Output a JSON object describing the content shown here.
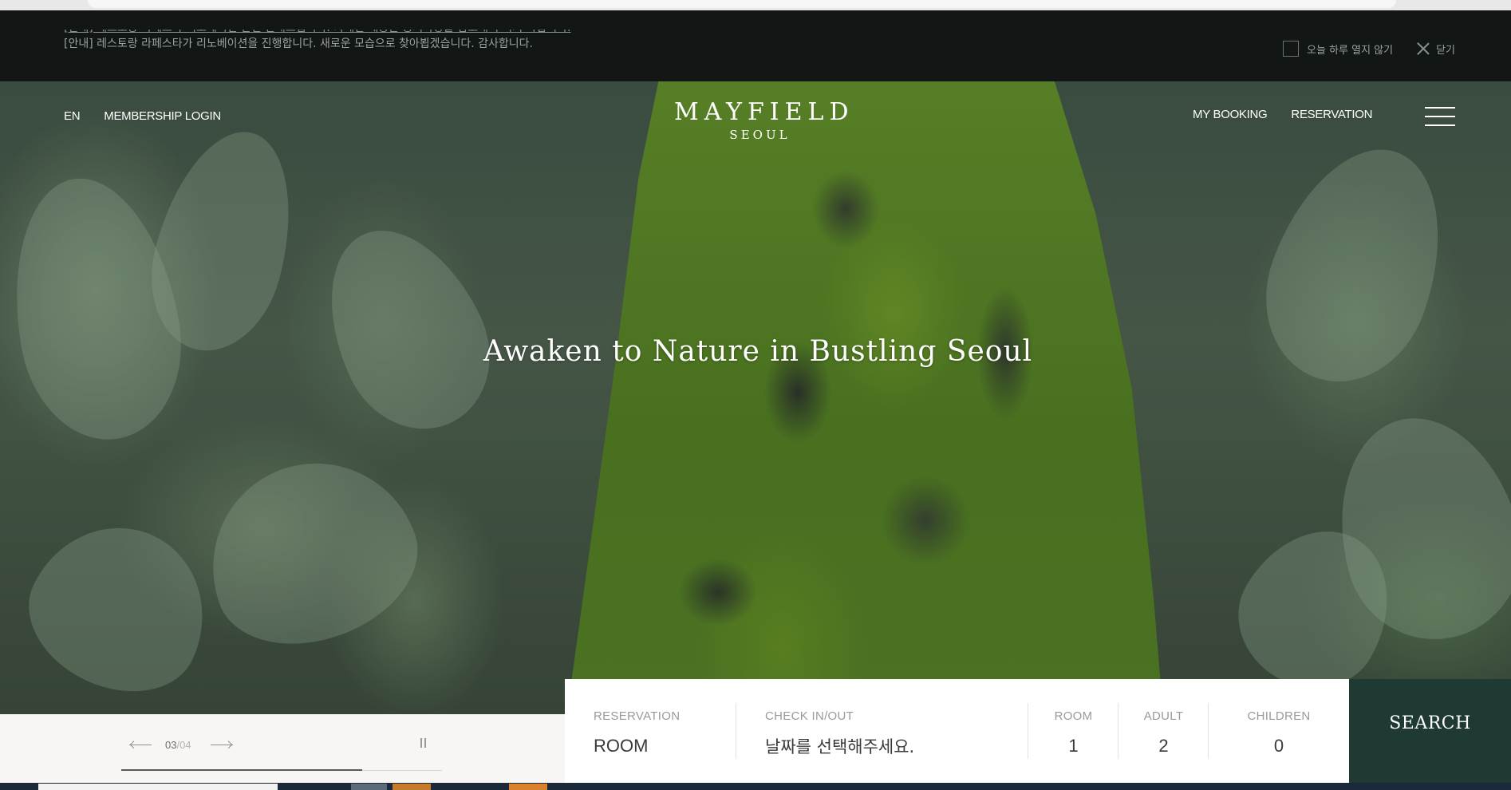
{
  "notice": {
    "prev_message": "[안내] 레스토랑 라페스타 리노베이션 관련 안내드립니다. 자세한 내용은 공지사항을 참고해 주시기 바랍니다.",
    "message": "[안내] 레스토랑 라페스타가 리노베이션을 진행합니다. 새로운 모습으로 찾아뵙겠습니다. 감사합니다.",
    "hide_today_label": "오늘 하루 열지 않기",
    "close_label": "닫기"
  },
  "header": {
    "lang": "EN",
    "membership_login": "MEMBERSHIP LOGIN",
    "logo_main": "MAYFIELD",
    "logo_sub": "SEOUL",
    "my_booking": "MY BOOKING",
    "reservation": "RESERVATION"
  },
  "hero": {
    "headline": "Awaken to Nature in Bustling Seoul"
  },
  "slider": {
    "current": "03",
    "total": "/04",
    "progress": 0.75
  },
  "booking": {
    "reservation_label": "RESERVATION",
    "reservation_value": "ROOM",
    "checkin_label": "CHECK IN/OUT",
    "checkin_placeholder": "날짜를 선택해주세요.",
    "room_label": "ROOM",
    "room_value": "1",
    "adult_label": "ADULT",
    "adult_value": "2",
    "children_label": "CHILDREN",
    "children_value": "0",
    "search_label": "SEARCH"
  },
  "colors": {
    "notice_bg": "#121716",
    "search_bg": "#1f3a33",
    "slider_bg": "#f8f6f3"
  }
}
